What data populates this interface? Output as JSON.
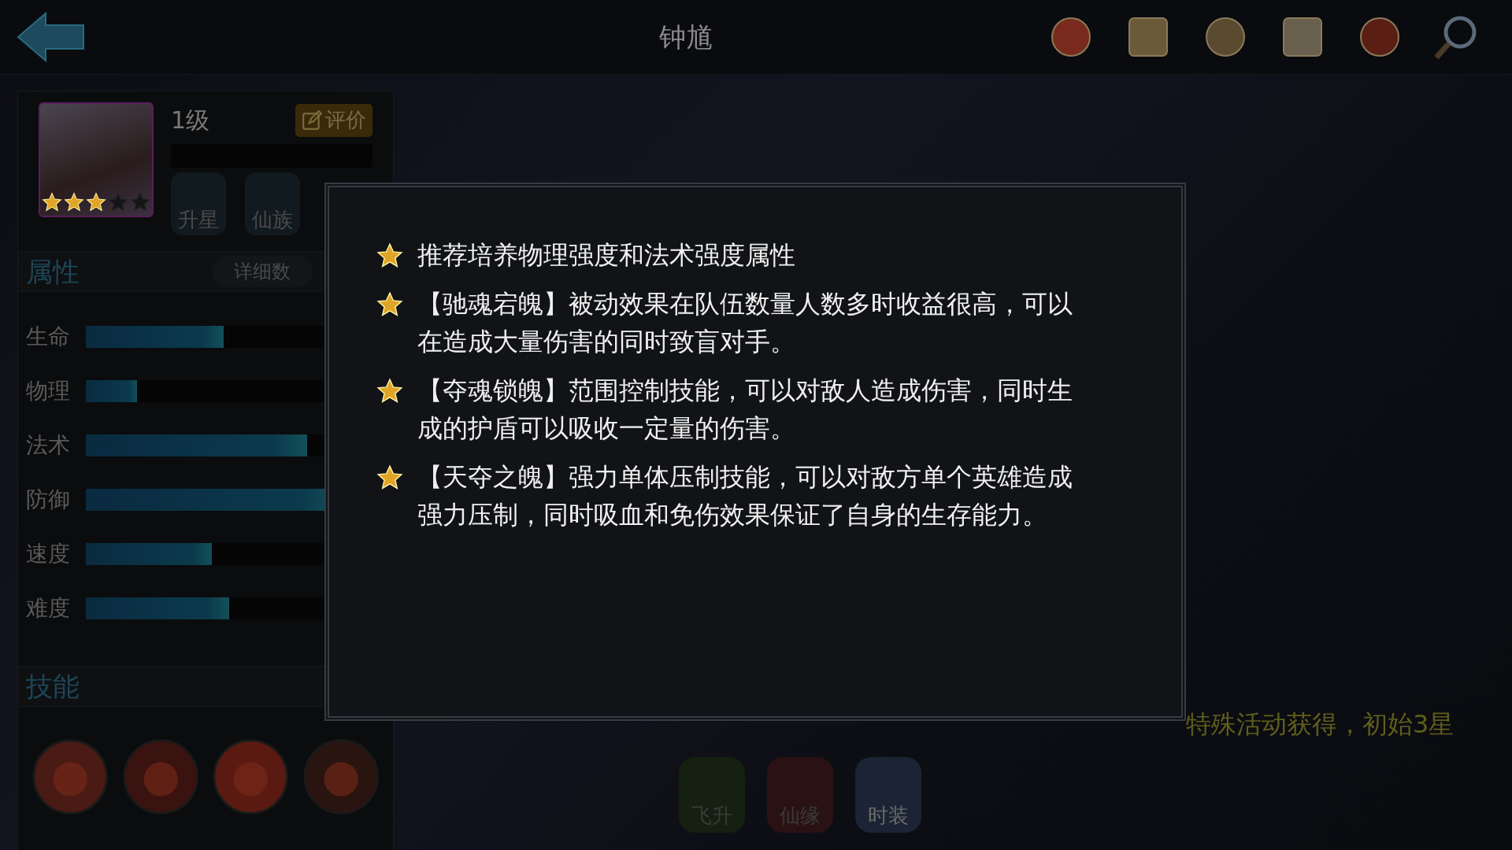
{
  "header": {
    "title": "钟馗"
  },
  "hero": {
    "stars": 3,
    "level": "1级",
    "rate_button": "评价",
    "badges": [
      "升星",
      "仙族"
    ]
  },
  "attributes": {
    "title": "属性",
    "details_button": "详细数",
    "stats": [
      {
        "label": "生命",
        "level": 0.46
      },
      {
        "label": "物理",
        "level": 0.17
      },
      {
        "label": "法术",
        "level": 0.74
      },
      {
        "label": "防御",
        "level": 0.85
      },
      {
        "label": "速度",
        "level": 0.42
      },
      {
        "label": "难度",
        "level": 0.48
      }
    ]
  },
  "skills": {
    "title": "技能"
  },
  "tips_dialog": {
    "tips": [
      "推荐培养物理强度和法术强度属性",
      "【驰魂宕魄】被动效果在队伍数量人数多时收益很高，可以在造成大量伤害的同时致盲对手。",
      "【夺魂锁魄】范围控制技能，可以对敌人造成伤害，同时生成的护盾可以吸收一定量的伤害。",
      "【天夺之魄】强力单体压制技能，可以对敌方单个英雄造成强力压制，同时吸血和免伤效果保证了自身的生存能力。"
    ]
  },
  "obtain_note": "特殊活动获得，初始3星",
  "bottom_tabs": [
    "飞升",
    "仙缘",
    "时装"
  ]
}
